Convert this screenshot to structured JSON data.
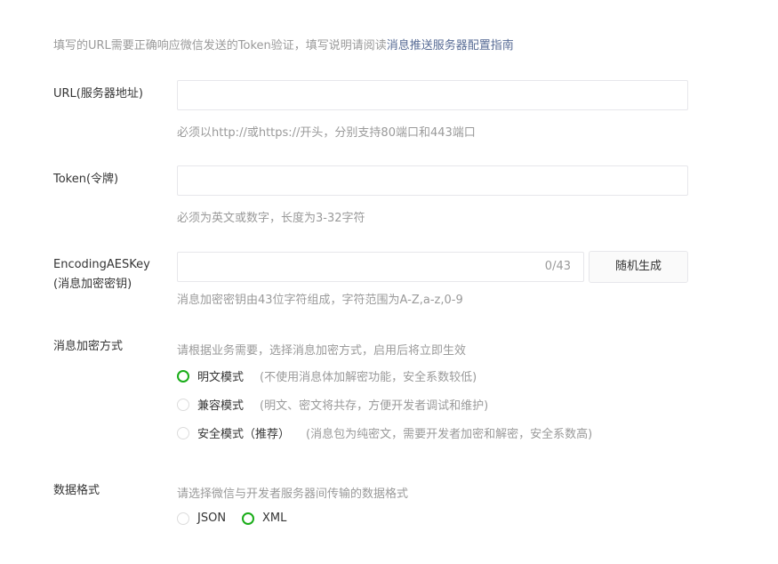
{
  "intro": {
    "text": "填写的URL需要正确响应微信发送的Token验证，填写说明请阅读",
    "link": "消息推送服务器配置指南"
  },
  "url": {
    "label": "URL(服务器地址)",
    "value": "",
    "hint": "必须以http://或https://开头，分别支持80端口和443端口"
  },
  "token": {
    "label": "Token(令牌)",
    "value": "",
    "hint": "必须为英文或数字，长度为3-32字符"
  },
  "aeskey": {
    "label_line1": "EncodingAESKey",
    "label_line2": "(消息加密密钥)",
    "value": "",
    "counter": "0/43",
    "random_button": "随机生成",
    "hint": "消息加密密钥由43位字符组成，字符范围为A-Z,a-z,0-9"
  },
  "encryption": {
    "label": "消息加密方式",
    "hint": "请根据业务需要，选择消息加密方式，启用后将立即生效",
    "options": [
      {
        "label": "明文模式",
        "desc": "(不使用消息体加解密功能，安全系数较低)",
        "checked": true
      },
      {
        "label": "兼容模式",
        "desc": "(明文、密文将共存，方便开发者调试和维护)",
        "checked": false
      },
      {
        "label": "安全模式（推荐）",
        "desc": "(消息包为纯密文，需要开发者加密和解密，安全系数高)",
        "checked": false
      }
    ]
  },
  "format": {
    "label": "数据格式",
    "hint": "请选择微信与开发者服务器间传输的数据格式",
    "options": [
      {
        "label": "JSON",
        "checked": false
      },
      {
        "label": "XML",
        "checked": true
      }
    ]
  },
  "colors": {
    "accent": "#1aad19",
    "link": "#576b95",
    "hint_text": "#9a9a9a",
    "border": "#e7e7eb"
  }
}
